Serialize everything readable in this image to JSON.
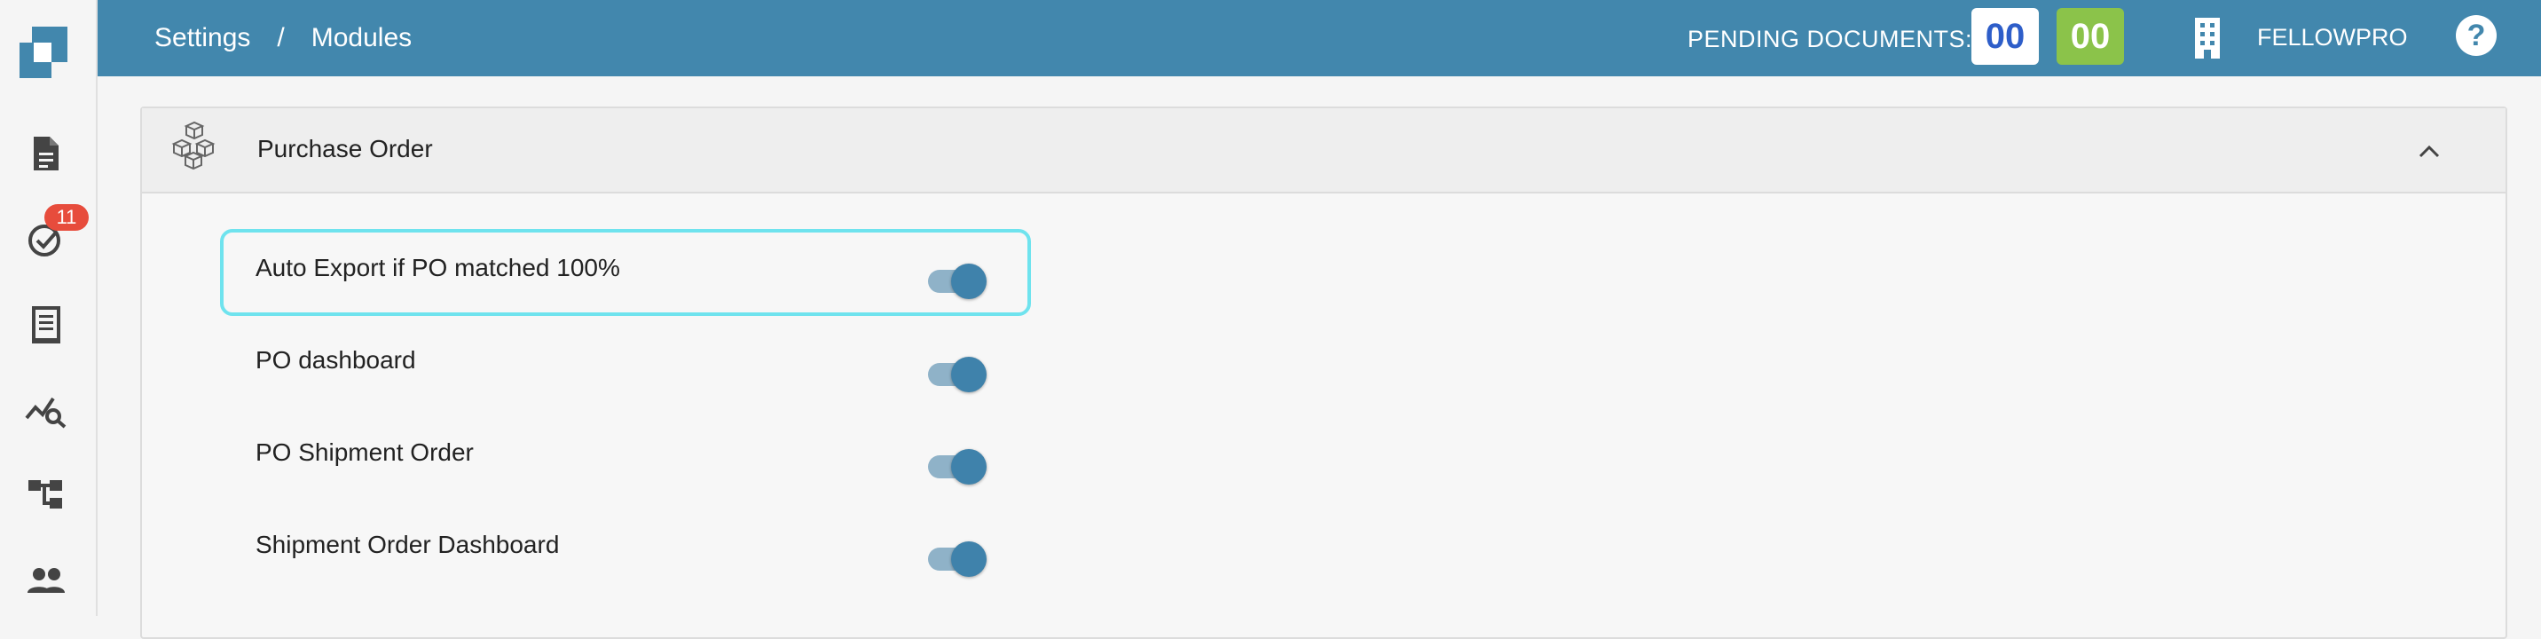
{
  "header": {
    "breadcrumb": [
      "Settings",
      "Modules"
    ],
    "breadcrumb_separator": "/",
    "pending_label": "PENDING DOCUMENTS:",
    "pending_count_1": "00",
    "pending_count_2": "00",
    "company": "FELLOWPRO",
    "help_icon": "?",
    "colors": {
      "header_bg": "#4287ad",
      "count_blue": "#2e5ec9",
      "count_green": "#8bc34a"
    }
  },
  "sidebar": {
    "items": [
      {
        "icon": "document-icon"
      },
      {
        "icon": "check-circle-icon",
        "badge": "11"
      },
      {
        "icon": "receipt-icon"
      },
      {
        "icon": "analytics-search-icon"
      },
      {
        "icon": "hierarchy-icon"
      },
      {
        "icon": "people-icon"
      }
    ]
  },
  "panel": {
    "title": "Purchase Order",
    "icon": "boxes-icon",
    "settings": [
      {
        "label": "Auto Export if PO matched 100%",
        "enabled": true,
        "focused": true
      },
      {
        "label": "PO dashboard",
        "enabled": true
      },
      {
        "label": "PO Shipment Order",
        "enabled": true
      },
      {
        "label": "Shipment Order Dashboard",
        "enabled": true
      }
    ]
  }
}
